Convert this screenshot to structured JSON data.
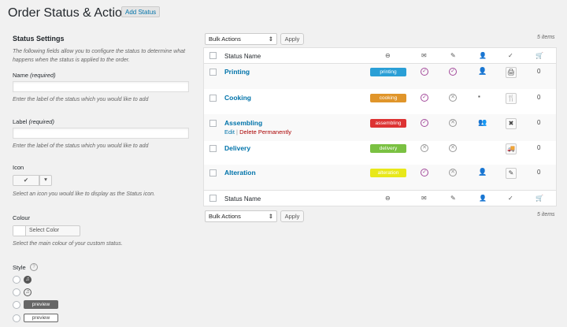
{
  "page": {
    "title": "Order Status & Actions",
    "add_button": "Add Status"
  },
  "form": {
    "heading": "Status Settings",
    "intro": "The following fields allow you to configure the status to determine what happens when the status is applied to the order.",
    "name_label": "Name",
    "name_required": "(required)",
    "name_help": "Enter the label of the status which you would like to add",
    "label_label": "Label",
    "label_required": "(required)",
    "label_help": "Enter the label of the status which you would like to add",
    "icon_label": "Icon",
    "icon_value": "✔",
    "icon_help": "Select an icon you would like to display as the Status icon.",
    "colour_label": "Colour",
    "colour_button": "Select Color",
    "colour_help": "Select the main colour of your custom status.",
    "style_label": "Style",
    "style_options": [
      "",
      "",
      "preview",
      "preview"
    ]
  },
  "bulk": {
    "label": "Bulk Actions",
    "apply": "Apply",
    "count": "5 items"
  },
  "table": {
    "col_name": "Status Name",
    "rows": [
      {
        "name": "Printing",
        "badge": "printing",
        "color": "#2a9fd6",
        "c1": "ok",
        "c2": "ok",
        "person": "👤",
        "action": "🖨",
        "num": "0"
      },
      {
        "name": "Cooking",
        "badge": "cooking",
        "color": "#e0952a",
        "c1": "ok",
        "c2": "no",
        "person": "▪",
        "action": "🍴",
        "num": "0"
      },
      {
        "name": "Assembling",
        "badge": "assembling",
        "color": "#dd3333",
        "c1": "ok",
        "c2": "no",
        "person": "👥",
        "action": "✖",
        "num": "0",
        "edit": "Edit",
        "sep": "|",
        "delete": "Delete Permanently"
      },
      {
        "name": "Delivery",
        "badge": "delivery",
        "color": "#7ac142",
        "c1": "no",
        "c2": "no",
        "person": "",
        "action": "🚚",
        "num": "0"
      },
      {
        "name": "Alteration",
        "badge": "alteration",
        "color": "#e8e81a",
        "c1": "ok",
        "c2": "no",
        "person": "👤",
        "action": "✎",
        "num": "0"
      }
    ]
  },
  "icons": {
    "header": [
      "minus-circle-icon",
      "mail-icon",
      "pencil-icon",
      "person-icon",
      "check-icon",
      "cart-icon"
    ]
  }
}
